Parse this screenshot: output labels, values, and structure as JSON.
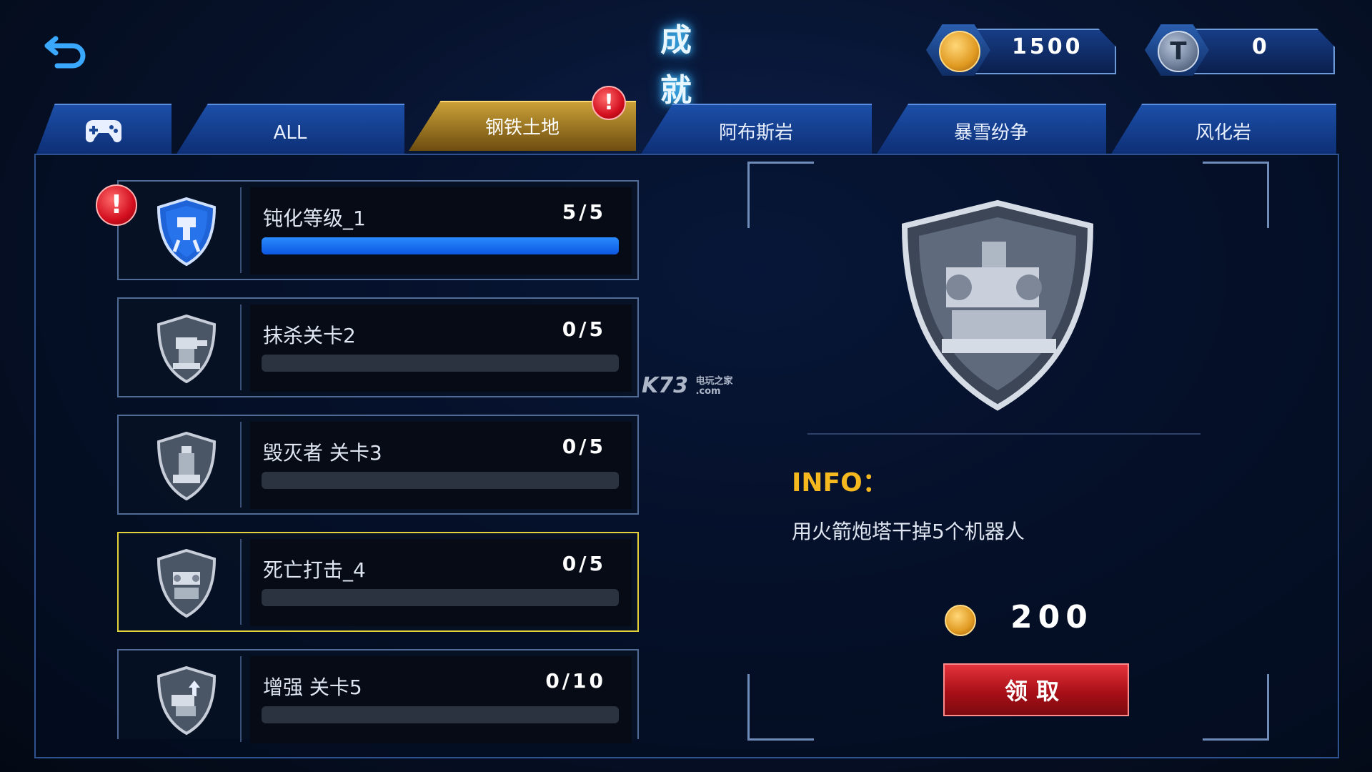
{
  "header": {
    "title": "成 就",
    "coins": "1500",
    "tokens": "0",
    "token_symbol": "T"
  },
  "tabs": [
    {
      "label": "",
      "icon": "gamepad-icon"
    },
    {
      "label": "ALL"
    },
    {
      "label": "钢铁土地",
      "active": true
    },
    {
      "label": "阿布斯岩"
    },
    {
      "label": "暴雪纷争"
    },
    {
      "label": "风化岩"
    }
  ],
  "alert_symbol": "!",
  "achievements": [
    {
      "name": "钝化等级_1",
      "progress": "5/5",
      "fraction": 1.0,
      "alert": true
    },
    {
      "name": "抹杀关卡2",
      "progress": "0/5",
      "fraction": 0
    },
    {
      "name": "毁灭者 关卡3",
      "progress": "0/5",
      "fraction": 0
    },
    {
      "name": "死亡打击_4",
      "progress": "0/5",
      "fraction": 0,
      "selected": true
    },
    {
      "name": "增强 关卡5",
      "progress": "0/10",
      "fraction": 0
    }
  ],
  "detail": {
    "info_label": "INFO：",
    "description": "用火箭炮塔干掉5个机器人",
    "reward": "200",
    "claim_label": "领取"
  },
  "watermark": {
    "brand": "K73",
    "sub1": "电玩之家",
    "sub2": ".com"
  },
  "colors": {
    "accent_gold": "#f5b81e",
    "tab_active": "#c9a037",
    "bar_fill": "#1f7bff",
    "claim_red": "#c8161f"
  }
}
